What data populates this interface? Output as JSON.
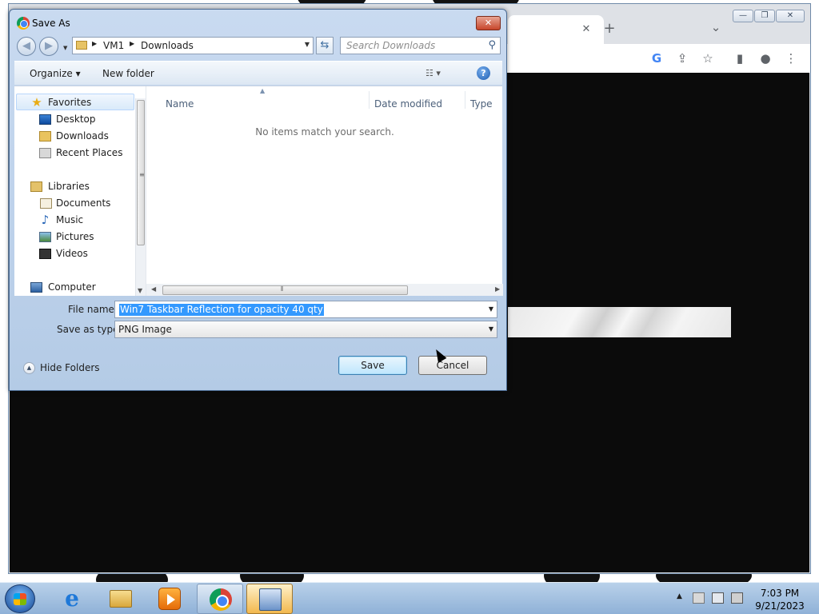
{
  "dialog": {
    "title": "Save As",
    "close_label": "✕",
    "back_glyph": "◀",
    "forward_glyph": "▶",
    "address_segments": [
      "VM1",
      "Downloads"
    ],
    "search_placeholder": "Search Downloads",
    "toolbar": {
      "organize": "Organize ▾",
      "new_folder": "New folder",
      "views_glyph": "☷ ▾",
      "help_glyph": "?"
    },
    "nav": {
      "items": [
        {
          "label": "Favorites",
          "icon": "star-icon"
        },
        {
          "label": "Desktop",
          "icon": "desktop-icon"
        },
        {
          "label": "Downloads",
          "icon": "downloads-folder-icon"
        },
        {
          "label": "Recent Places",
          "icon": "recent-places-icon"
        },
        {
          "label": "Libraries",
          "icon": "libraries-icon"
        },
        {
          "label": "Documents",
          "icon": "documents-icon"
        },
        {
          "label": "Music",
          "icon": "music-icon"
        },
        {
          "label": "Pictures",
          "icon": "pictures-icon"
        },
        {
          "label": "Videos",
          "icon": "videos-icon"
        },
        {
          "label": "Computer",
          "icon": "computer-icon"
        }
      ]
    },
    "columns": [
      "Name",
      "Date modified",
      "Type"
    ],
    "empty_message": "No items match your search.",
    "file_name_label": "File name:",
    "file_name_value": "Win7 Taskbar Reflection for opacity 40 qty",
    "save_as_type_label": "Save as type:",
    "save_as_type_value": "PNG Image",
    "hide_folders": "Hide Folders",
    "save_button": "Save",
    "cancel_button": "Cancel"
  },
  "browser": {
    "tab_close": "✕",
    "new_tab": "+",
    "tab_list": "⌄",
    "minimize": "—",
    "restore": "❐",
    "close": "✕",
    "toolbar_icons": [
      "G",
      "⇪",
      "☆",
      "▮",
      "●",
      "⋮"
    ]
  },
  "taskbar": {
    "time": "7:03 PM",
    "date": "9/21/2023",
    "apps": [
      "internet-explorer-icon",
      "windows-explorer-icon",
      "windows-media-player-icon",
      "google-chrome-icon",
      "installer-icon"
    ],
    "tray_arrow": "▲"
  },
  "colors": {
    "selection": "#3399ff",
    "dialog_frame": "#b4cbe6",
    "close_button": "#c7452a",
    "taskbar": "#8fb1d7"
  }
}
